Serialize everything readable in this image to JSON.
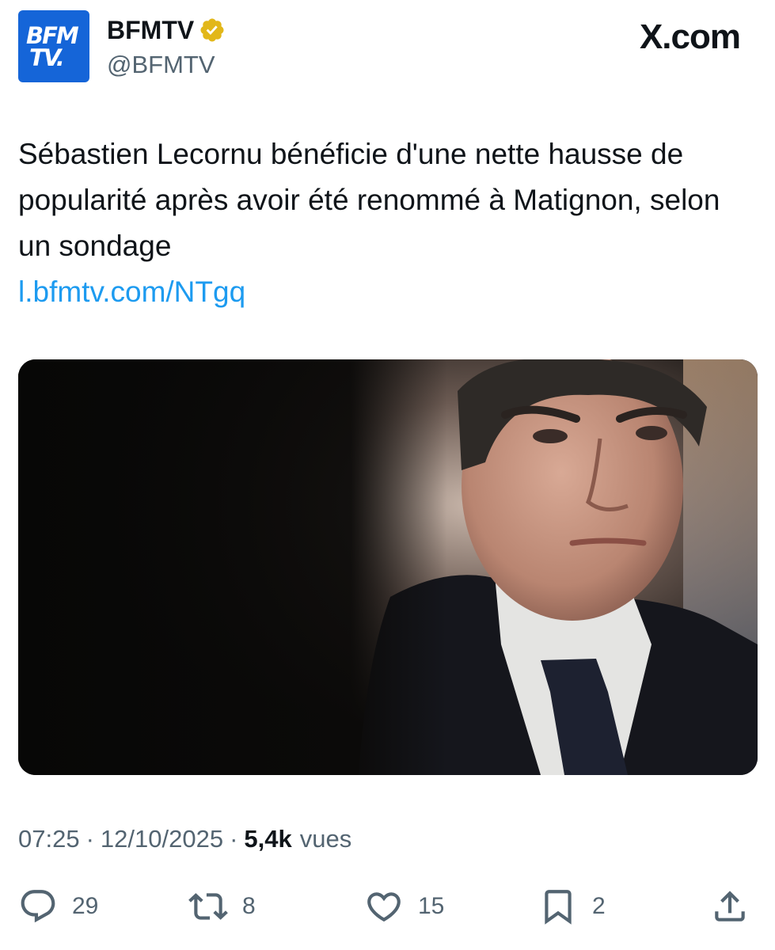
{
  "author": {
    "logo_line1": "BFM",
    "logo_line2": "TV.",
    "display_name": "BFMTV",
    "handle": "@BFMTV",
    "verified": true
  },
  "brand": "X.com",
  "tweet": {
    "text": "Sébastien Lecornu bénéficie d'une nette hausse de popularité après avoir été renommé à Matignon, selon un sondage",
    "link": "l.bfmtv.com/NTgq"
  },
  "meta": {
    "time": "07:25",
    "separator": "·",
    "date": "12/10/2025",
    "views_count": "5,4k",
    "views_label": "vues"
  },
  "actions": {
    "replies": "29",
    "reposts": "8",
    "likes": "15",
    "bookmarks": "2"
  },
  "icons": {
    "reply": "reply-icon",
    "repost": "repost-icon",
    "like": "heart-icon",
    "bookmark": "bookmark-icon",
    "share": "share-icon",
    "verified": "verified-badge-icon"
  },
  "colors": {
    "link": "#1d9bf0",
    "muted": "#536471",
    "text": "#0f1419",
    "verified_badge": "#e2b719",
    "logo_bg": "#1565d8"
  }
}
